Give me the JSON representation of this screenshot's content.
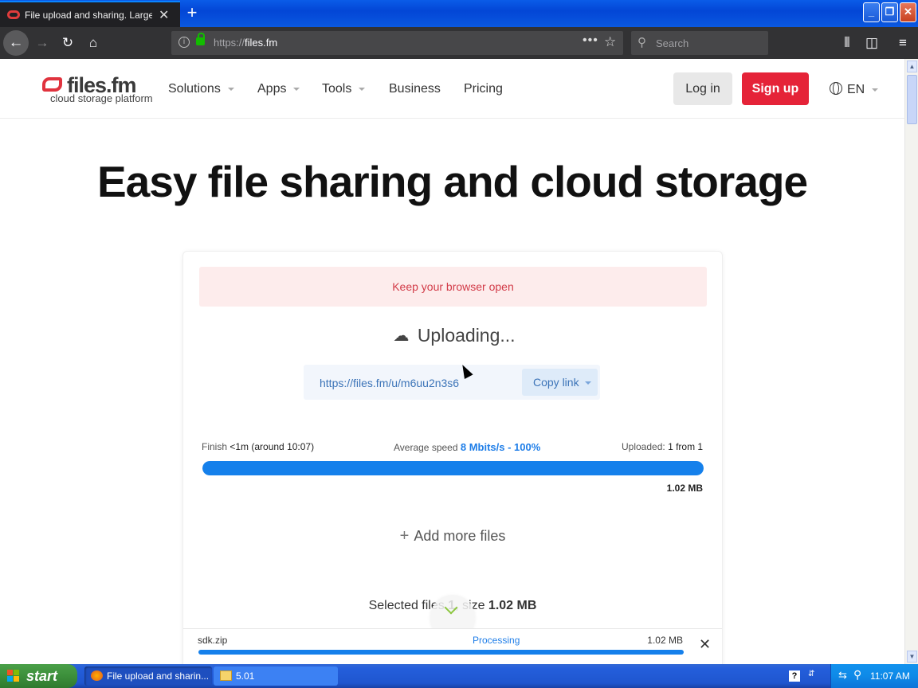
{
  "browser": {
    "tab_title": "File upload and sharing. Large file",
    "tab_close": "✕",
    "new_tab": "+",
    "url_proto": "https://",
    "url_host": "files.fm",
    "url_more": "•••",
    "search_placeholder": "Search",
    "window_buttons": {
      "minimize": "_",
      "restore": "❐",
      "close": "✕"
    }
  },
  "site": {
    "logo_text": "files.fm",
    "logo_tagline": "cloud storage platform",
    "menu": [
      {
        "label": "Solutions",
        "has_caret": true
      },
      {
        "label": "Apps",
        "has_caret": true
      },
      {
        "label": "Tools",
        "has_caret": true
      },
      {
        "label": "Business",
        "has_caret": false
      },
      {
        "label": "Pricing",
        "has_caret": false
      }
    ],
    "login_label": "Log in",
    "signup_label": "Sign up",
    "language": "EN",
    "accent_color": "#e52338"
  },
  "hero": {
    "title": "Easy file sharing and cloud storage"
  },
  "upload": {
    "warning": "Keep your browser open",
    "status": "Uploading...",
    "share_link": "https://files.fm/u/m6uu2n3s6",
    "copy_link_label": "Copy link",
    "finish_label": "Finish",
    "finish_value": "<1m (around 10:07)",
    "speed_label": "Average speed",
    "speed_value": "8 Mbits/s - 100%",
    "uploaded_label": "Uploaded:",
    "uploaded_value": "1 from 1",
    "progress_percent": 100,
    "total_size": "1.02 MB",
    "add_more_label": "Add more files",
    "selected_prefix": "Selected files",
    "selected_count": "1",
    "selected_size_prefix": ", size",
    "selected_size": "1.02 MB",
    "progress_color": "#1580eb"
  },
  "files": [
    {
      "name": "sdk.zip",
      "state": "Processing",
      "size": "1.02 MB",
      "progress_percent": 100
    }
  ],
  "taskbar": {
    "start_label": "start",
    "tasks": [
      {
        "label": "File upload and sharin...",
        "icon": "firefox-icon"
      },
      {
        "label": "5.01",
        "icon": "folder-icon"
      }
    ],
    "help": "?",
    "clock": "11:07 AM"
  }
}
